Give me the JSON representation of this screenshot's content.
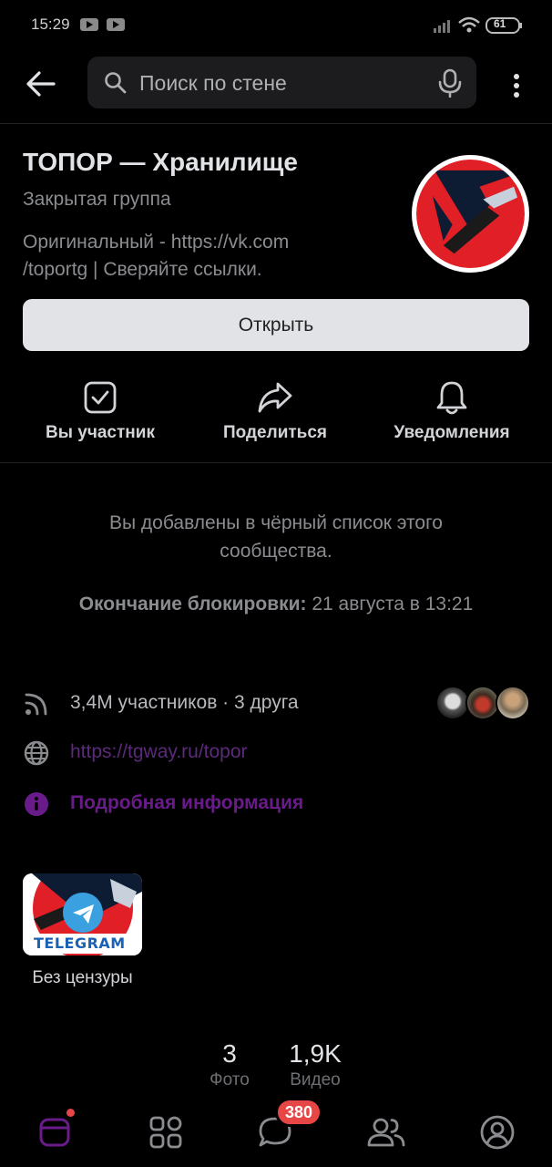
{
  "status_bar": {
    "time": "15:29",
    "battery": "61"
  },
  "search": {
    "placeholder": "Поиск по стене"
  },
  "group": {
    "title": "ТОПОР — Хранилище",
    "type": "Закрытая группа",
    "description_line1": "Оригинальный - https://vk.com",
    "description_line2": "/toportg | Сверяйте ссылки."
  },
  "open_button": "Открыть",
  "actions": [
    {
      "label": "Вы участник",
      "icon": "checkbox-icon"
    },
    {
      "label": "Поделиться",
      "icon": "share-icon"
    },
    {
      "label": "Уведомления",
      "icon": "bell-icon"
    }
  ],
  "blocked": {
    "message": "Вы добавлены в чёрный список этого сообщества.",
    "end_label": "Окончание блокировки:",
    "end_value": " 21 августа в 13:21"
  },
  "info": {
    "members": "3,4M участников · 3 друга",
    "link": "https://tgway.ru/topor",
    "details": "Подробная информация"
  },
  "album": {
    "label": "Без цензуры",
    "badge_text": "TELEGRAM"
  },
  "counters": [
    {
      "value": "3",
      "caption": "Фото"
    },
    {
      "value": "1,9K",
      "caption": "Видео"
    }
  ],
  "tabbar": {
    "messages_badge": "380"
  },
  "colors": {
    "accent_purple": "#6a1b8a",
    "badge_red": "#e64646",
    "link_purple": "#5c2a7a"
  }
}
